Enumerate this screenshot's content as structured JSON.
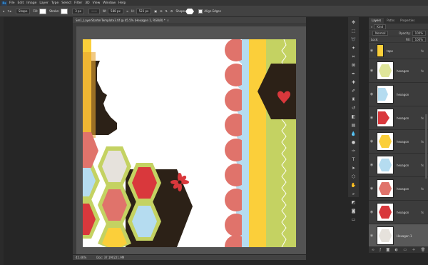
{
  "menubar": {
    "items": [
      "File",
      "Edit",
      "Image",
      "Layer",
      "Type",
      "Select",
      "Filter",
      "3D",
      "View",
      "Window",
      "Help"
    ]
  },
  "options": {
    "mode": "Shape",
    "fill_label": "Fill:",
    "stroke_label": "Stroke:",
    "stroke_size": "3 px",
    "w_label": "W:",
    "w_value": "588 px",
    "h_label": "H:",
    "h_value": "523 px",
    "shape_label": "Shape:",
    "align_edges": "Align Edges"
  },
  "document": {
    "tab_title": "Sm1_LayerStarterTemplate3.tif @ 45.5% (Hexagon 1, RGB/8) *",
    "close": "×"
  },
  "status": {
    "zoom": "45.46%",
    "doc": "Doc: 37.1M/221.9M"
  },
  "panel": {
    "tabs": [
      "Layers",
      "Paths",
      "Properties"
    ],
    "kind": "Kind",
    "blend": "Normal",
    "opacity_label": "Opacity:",
    "opacity_value": "100%",
    "lock_label": "Lock:",
    "fill_label": "Fill:",
    "fill_value": "100%",
    "layers": [
      {
        "name": "tape",
        "fx": "fx"
      },
      {
        "name": "hexagon",
        "fx": "fx"
      },
      {
        "name": "hexagon",
        "fx": ""
      },
      {
        "name": "hexagon",
        "fx": "fx"
      },
      {
        "name": "hexagon",
        "fx": "fx"
      },
      {
        "name": "hexagon",
        "fx": "fx"
      },
      {
        "name": "hexagon",
        "fx": "fx"
      },
      {
        "name": "hexagon",
        "fx": "fx"
      },
      {
        "name": "Hexagon 1",
        "fx": ""
      }
    ]
  },
  "colors": {
    "red": "#d9383c",
    "salmon": "#e0736b",
    "yellow": "#fbcf3a",
    "blue": "#b5dcf0",
    "green": "#c4d262",
    "brown": "#2c2117",
    "cream": "#e6e2dc"
  }
}
